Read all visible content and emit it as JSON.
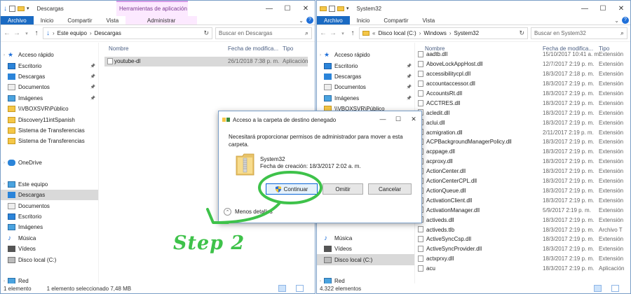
{
  "left": {
    "title": "Descargas",
    "context_tab": "Herramientas de aplicación",
    "tabs": [
      "Archivo",
      "Inicio",
      "Compartir",
      "Vista",
      "Administrar"
    ],
    "breadcrumb": [
      "Este equipo",
      "Descargas"
    ],
    "search_placeholder": "Buscar en Descargas",
    "sidebar": [
      {
        "label": "Acceso rápido",
        "icon": "star-icon",
        "pinned": false
      },
      {
        "label": "Escritorio",
        "icon": "desktop-icon",
        "pinned": true
      },
      {
        "label": "Descargas",
        "icon": "download-icon",
        "pinned": true
      },
      {
        "label": "Documentos",
        "icon": "documents-icon",
        "pinned": true
      },
      {
        "label": "Imágenes",
        "icon": "pictures-icon",
        "pinned": true
      },
      {
        "label": "\\\\VBOXSVR\\Público",
        "icon": "network-folder-icon",
        "pinned": false
      },
      {
        "label": "Discovery11intSpanish",
        "icon": "folder-icon",
        "pinned": false
      },
      {
        "label": "Sistema de Transferencias",
        "icon": "folder-icon",
        "pinned": false
      },
      {
        "label": "Sistema de Transferencias",
        "icon": "folder-icon",
        "pinned": false
      },
      {
        "label": "",
        "icon": "",
        "pinned": false
      },
      {
        "label": "OneDrive",
        "icon": "onedrive-icon",
        "pinned": false
      },
      {
        "label": "",
        "icon": "",
        "pinned": false
      },
      {
        "label": "Este equipo",
        "icon": "computer-icon",
        "pinned": false
      },
      {
        "label": "Descargas",
        "icon": "download-icon",
        "pinned": false,
        "selected": true
      },
      {
        "label": "Documentos",
        "icon": "documents-icon",
        "pinned": false
      },
      {
        "label": "Escritorio",
        "icon": "desktop-icon",
        "pinned": false
      },
      {
        "label": "Imágenes",
        "icon": "pictures-icon",
        "pinned": false
      },
      {
        "label": "Música",
        "icon": "music-icon",
        "pinned": false
      },
      {
        "label": "Vídeos",
        "icon": "video-icon",
        "pinned": false
      },
      {
        "label": "Disco local (C:)",
        "icon": "drive-icon",
        "pinned": false
      },
      {
        "label": "",
        "icon": "",
        "pinned": false
      },
      {
        "label": "Red",
        "icon": "network-icon",
        "pinned": false
      }
    ],
    "headers": [
      "Nombre",
      "Fecha de modifica...",
      "Tipo"
    ],
    "files": [
      {
        "name": "youtube-dl",
        "date": "26/1/2018 7:38 p. m.",
        "type": "Aplicación"
      }
    ],
    "status": [
      "1 elemento",
      "1 elemento seleccionado  7,48 MB"
    ]
  },
  "right": {
    "title": "System32",
    "tabs": [
      "Archivo",
      "Inicio",
      "Compartir",
      "Vista"
    ],
    "breadcrumb": [
      "Disco local (C:)",
      "Windows",
      "System32"
    ],
    "search_placeholder": "Buscar en System32",
    "sidebar": [
      {
        "label": "Acceso rápido",
        "icon": "star-icon",
        "pinned": false
      },
      {
        "label": "Escritorio",
        "icon": "desktop-icon",
        "pinned": true
      },
      {
        "label": "Descargas",
        "icon": "download-icon",
        "pinned": true
      },
      {
        "label": "Documentos",
        "icon": "documents-icon",
        "pinned": true
      },
      {
        "label": "Imágenes",
        "icon": "pictures-icon",
        "pinned": true
      },
      {
        "label": "\\\\VBOXSVR\\Público",
        "icon": "network-folder-icon",
        "pinned": false
      },
      {
        "label": "",
        "icon": "",
        "pinned": false
      },
      {
        "label": "",
        "icon": "",
        "pinned": false
      },
      {
        "label": "",
        "icon": "",
        "pinned": false
      },
      {
        "label": "",
        "icon": "",
        "pinned": false
      },
      {
        "label": "",
        "icon": "",
        "pinned": false
      },
      {
        "label": "",
        "icon": "",
        "pinned": false
      },
      {
        "label": "",
        "icon": "",
        "pinned": false
      },
      {
        "label": "",
        "icon": "",
        "pinned": false
      },
      {
        "label": "",
        "icon": "",
        "pinned": false
      },
      {
        "label": "",
        "icon": "",
        "pinned": false
      },
      {
        "label": "",
        "icon": "",
        "pinned": false
      },
      {
        "label": "Música",
        "icon": "music-icon",
        "pinned": false
      },
      {
        "label": "Vídeos",
        "icon": "video-icon",
        "pinned": false
      },
      {
        "label": "Disco local (C:)",
        "icon": "drive-icon",
        "pinned": false,
        "selected": true
      },
      {
        "label": "",
        "icon": "",
        "pinned": false
      },
      {
        "label": "Red",
        "icon": "network-icon",
        "pinned": false
      }
    ],
    "headers": [
      "Nombre",
      "Fecha de modifica...",
      "Tipo"
    ],
    "files": [
      {
        "name": "aadtb.dll",
        "date": "15/10/2017 10:41 a. m.",
        "type": "Extensión"
      },
      {
        "name": "AboveLockAppHost.dll",
        "date": "12/7/2017 2:19 p. m.",
        "type": "Extensión"
      },
      {
        "name": "accessibilitycpl.dll",
        "date": "18/3/2017 2:18 p. m.",
        "type": "Extensión"
      },
      {
        "name": "accountaccessor.dll",
        "date": "18/3/2017 2:19 p. m.",
        "type": "Extensión"
      },
      {
        "name": "AccountsRt.dll",
        "date": "18/3/2017 2:19 p. m.",
        "type": "Extensión"
      },
      {
        "name": "ACCTRES.dll",
        "date": "18/3/2017 2:19 p. m.",
        "type": "Extensión"
      },
      {
        "name": "acledit.dll",
        "date": "18/3/2017 2:19 p. m.",
        "type": "Extensión"
      },
      {
        "name": "aclui.dll",
        "date": "18/3/2017 2:19 p. m.",
        "type": "Extensión"
      },
      {
        "name": "acmigration.dll",
        "date": "2/11/2017 2:19 p. m.",
        "type": "Extensión"
      },
      {
        "name": "ACPBackgroundManagerPolicy.dll",
        "date": "18/3/2017 2:19 p. m.",
        "type": "Extensión"
      },
      {
        "name": "acppage.dll",
        "date": "18/3/2017 2:19 p. m.",
        "type": "Extensión"
      },
      {
        "name": "acproxy.dll",
        "date": "18/3/2017 2:19 p. m.",
        "type": "Extensión"
      },
      {
        "name": "ActionCenter.dll",
        "date": "18/3/2017 2:19 p. m.",
        "type": "Extensión"
      },
      {
        "name": "ActionCenterCPL.dll",
        "date": "18/3/2017 2:19 p. m.",
        "type": "Extensión"
      },
      {
        "name": "ActionQueue.dll",
        "date": "18/3/2017 2:19 p. m.",
        "type": "Extensión"
      },
      {
        "name": "ActivationClient.dll",
        "date": "18/3/2017 2:19 p. m.",
        "type": "Extensión"
      },
      {
        "name": "ActivationManager.dll",
        "date": "5/9/2017 2:19 p. m.",
        "type": "Extensión"
      },
      {
        "name": "activeds.dll",
        "date": "18/3/2017 2:19 p. m.",
        "type": "Extensión"
      },
      {
        "name": "activeds.tlb",
        "date": "18/3/2017 2:19 p. m.",
        "type": "Archivo T"
      },
      {
        "name": "ActiveSyncCsp.dll",
        "date": "18/3/2017 2:19 p. m.",
        "type": "Extensión"
      },
      {
        "name": "ActiveSyncProvider.dll",
        "date": "18/3/2017 2:19 p. m.",
        "type": "Extensión"
      },
      {
        "name": "actxprxy.dll",
        "date": "18/3/2017 2:19 p. m.",
        "type": "Extensión"
      },
      {
        "name": "acu",
        "date": "18/3/2017 2:19 p. m.",
        "type": "Aplicación"
      }
    ],
    "status": [
      "4.322 elementos"
    ]
  },
  "dialog": {
    "title": "Acceso a la carpeta de destino denegado",
    "message": "Necesitará proporcionar permisos de administrador para mover a esta carpeta.",
    "folder_name": "System32",
    "folder_created": "Fecha de creación: 18/3/2017 2:02 a. m.",
    "continue_label": "Continuar",
    "skip_label": "Omitir",
    "cancel_label": "Cancelar",
    "more_details": "Menos detalles"
  },
  "annotation": {
    "step_text": "Step 2",
    "color": "#3ec24a"
  }
}
